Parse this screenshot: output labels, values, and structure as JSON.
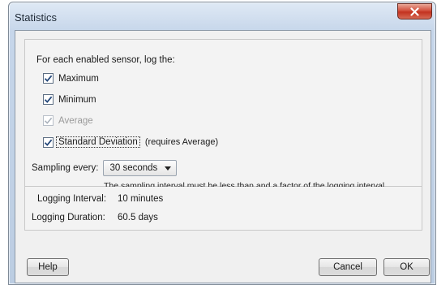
{
  "window": {
    "title": "Statistics"
  },
  "panel": {
    "intro": "For each enabled sensor, log the:",
    "checkboxes": [
      {
        "label": "Maximum",
        "checked": true,
        "enabled": true
      },
      {
        "label": "Minimum",
        "checked": true,
        "enabled": true
      },
      {
        "label": "Average",
        "checked": true,
        "enabled": false
      },
      {
        "label": "Standard Deviation",
        "checked": true,
        "enabled": true,
        "note": "(requires Average)"
      }
    ],
    "sampling": {
      "label": "Sampling every:",
      "value": "30 seconds",
      "hint": "The sampling interval must be less than and a factor of the logging interval."
    }
  },
  "info": {
    "interval_label": "Logging Interval:",
    "interval_value": "10 minutes",
    "duration_label": "Logging Duration:",
    "duration_value": "60.5 days"
  },
  "buttons": {
    "help": "Help",
    "cancel": "Cancel",
    "ok": "OK"
  },
  "icons": {
    "close": "close-icon",
    "check": "checkmark-icon",
    "dropdown": "chevron-down-icon"
  },
  "colors": {
    "close_button": "#c3321f",
    "title_bar": "#c6d6ea",
    "dialog_bg": "#f0f0f0"
  }
}
